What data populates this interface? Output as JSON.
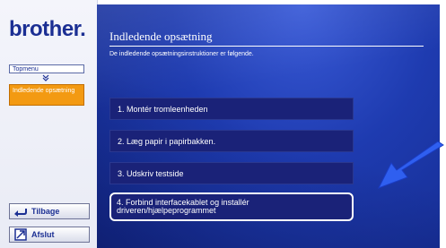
{
  "sidebar": {
    "logo": "brother.",
    "nav_top": "Topmenu",
    "nav_current": "Indledende opsætning",
    "back_label": "Tilbage",
    "exit_label": "Afslut"
  },
  "main": {
    "title": "Indledende opsætning",
    "subtitle": "De indledende opsætningsinstruktioner er følgende.",
    "steps": [
      {
        "label": "1. Montér tromleenheden"
      },
      {
        "label": "2. Læg papir i papirbakken."
      },
      {
        "label": "3. Udskriv testside"
      },
      {
        "label": "4. Forbind interfacekablet og installér driveren/hjælpeprogrammet"
      }
    ]
  },
  "colors": {
    "brand": "#1b2f93",
    "accent_orange": "#f39a12",
    "panel_blue": "#1e3bb0",
    "pointer_blue": "#2f5ff0"
  },
  "icons": [
    "back-arrow-icon",
    "exit-icon",
    "down-arrow-icon",
    "pointer-arrow-icon"
  ]
}
